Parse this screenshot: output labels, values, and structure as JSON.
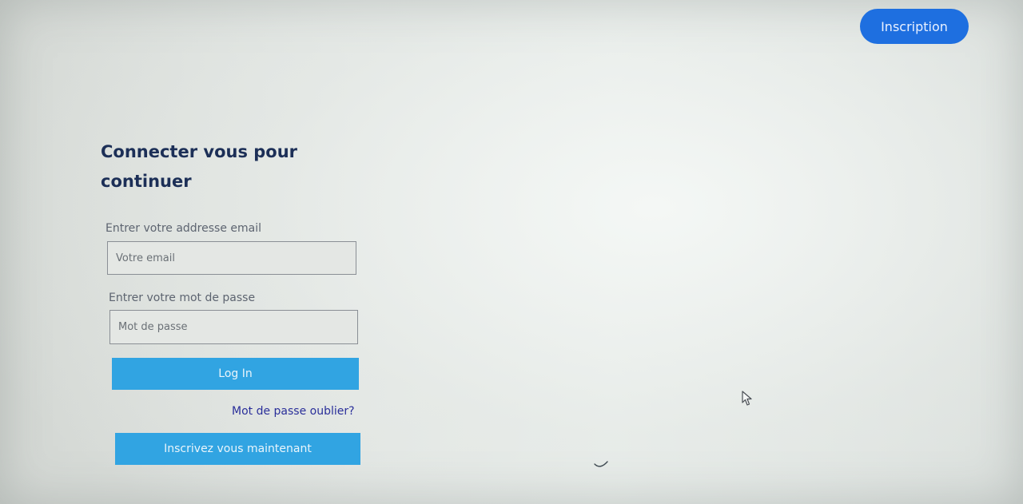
{
  "header": {
    "signup_label": "Inscription"
  },
  "login": {
    "title_line1": "Connecter vous pour",
    "title_line2": "continuer",
    "email_label": "Entrer votre addresse email",
    "email_placeholder": "Votre email",
    "email_value": "",
    "password_label": "Entrer votre mot de passe",
    "password_placeholder": "Mot de passe",
    "password_value": "",
    "login_button": "Log In",
    "forgot_link": "Mot de passe oublier?",
    "register_button": "Inscrivez vous maintenant"
  },
  "colors": {
    "accent": "#1e6fe0",
    "button_blue": "#31a4e2",
    "title": "#1c2f57",
    "link": "#2a2f9a"
  },
  "icons": {
    "cursor": "mouse-pointer-icon",
    "spinner": "loading-arc-icon"
  }
}
